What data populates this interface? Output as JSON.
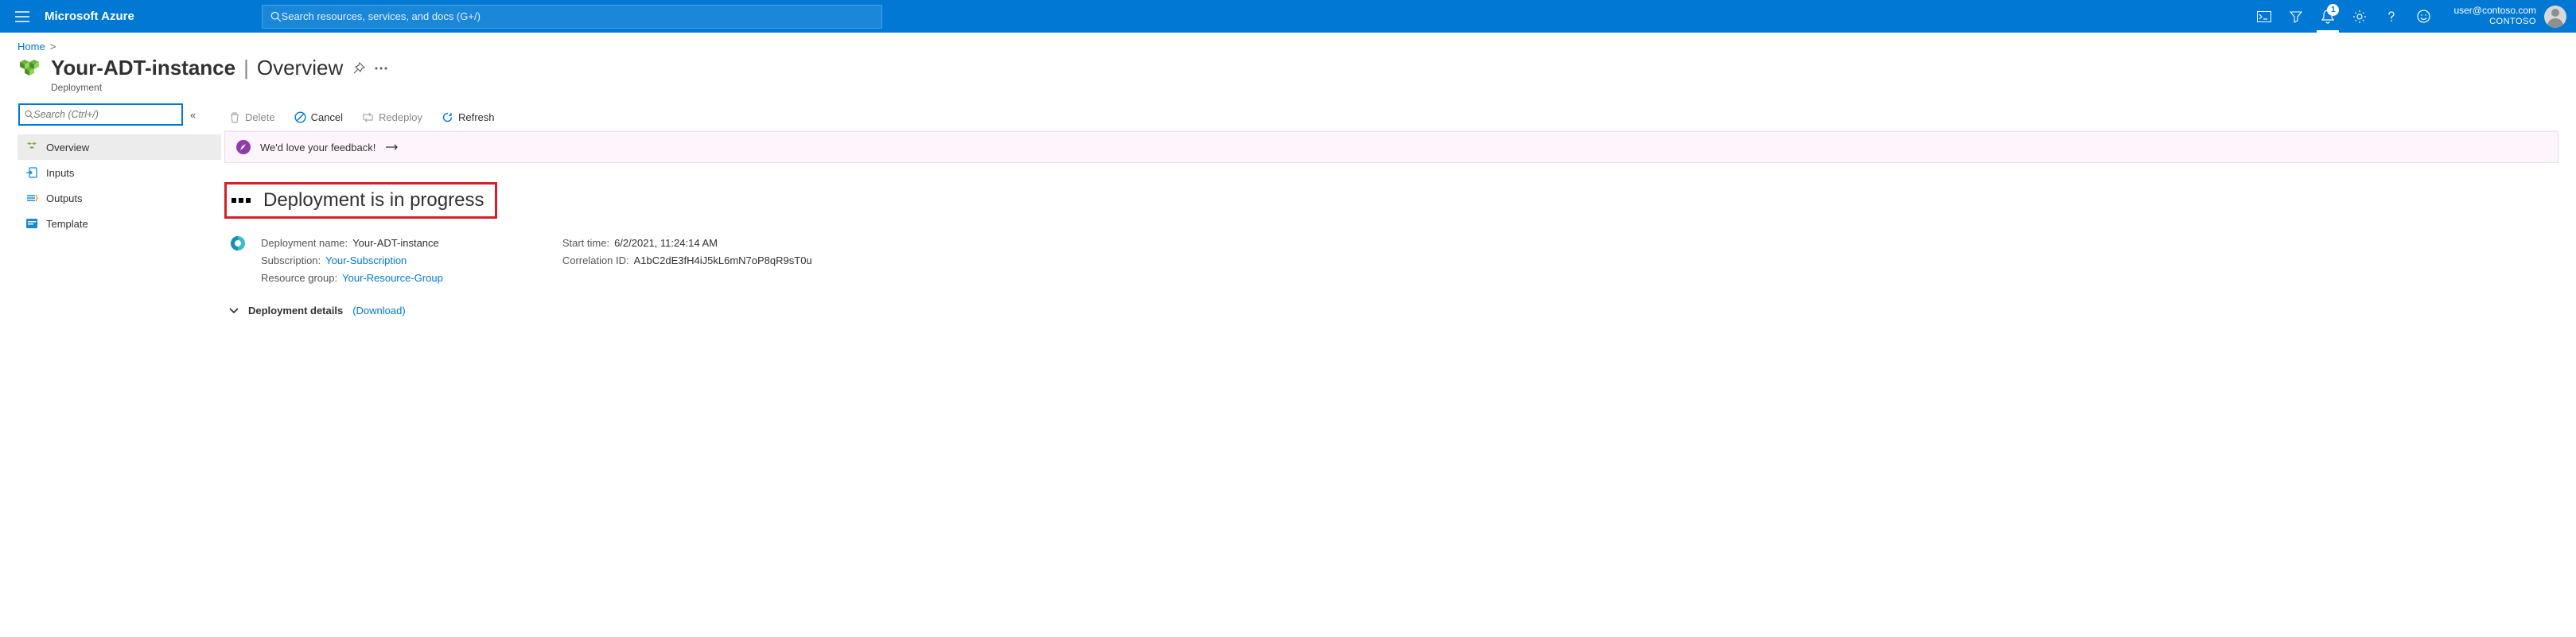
{
  "topbar": {
    "brand": "Microsoft Azure",
    "search_placeholder": "Search resources, services, and docs (G+/)",
    "notifications_count": "1",
    "account_email": "user@contoso.com",
    "account_directory": "CONTOSO"
  },
  "breadcrumb": {
    "home": "Home"
  },
  "title": {
    "name": "Your-ADT-instance",
    "section": "Overview",
    "subtitle": "Deployment"
  },
  "sidebar": {
    "search_placeholder": "Search (Ctrl+/)",
    "items": [
      {
        "label": "Overview"
      },
      {
        "label": "Inputs"
      },
      {
        "label": "Outputs"
      },
      {
        "label": "Template"
      }
    ]
  },
  "toolbar": {
    "delete": "Delete",
    "cancel": "Cancel",
    "redeploy": "Redeploy",
    "refresh": "Refresh"
  },
  "feedback": {
    "text": "We'd love your feedback!"
  },
  "deployment": {
    "status": "Deployment is in progress",
    "name_label": "Deployment name:",
    "name_value": "Your-ADT-instance",
    "subscription_label": "Subscription:",
    "subscription_value": "Your-Subscription",
    "rg_label": "Resource group:",
    "rg_value": "Your-Resource-Group",
    "start_label": "Start time:",
    "start_value": "6/2/2021, 11:24:14 AM",
    "correlation_label": "Correlation ID:",
    "correlation_value": "A1bC2dE3fH4iJ5kL6mN7oP8qR9sT0u"
  },
  "dep_details": {
    "label": "Deployment details",
    "download": "(Download)"
  }
}
